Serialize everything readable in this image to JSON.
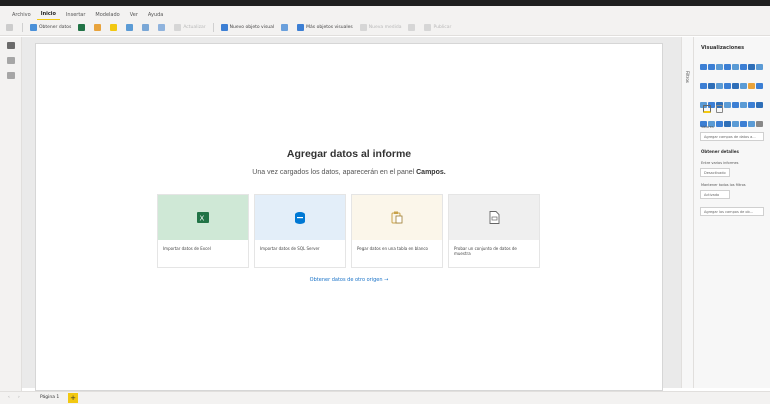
{
  "menu": [
    "Archivo",
    "Inicio",
    "Insertar",
    "Modelado",
    "Ver",
    "Ayuda"
  ],
  "ribbon": {
    "get_data": "Obtener datos",
    "import": "Actualizar",
    "new_visual": "Nuevo objeto visual",
    "more_visuals": "Más objetos visuales",
    "new_measure": "Nueva medida",
    "publish": "Publicar"
  },
  "main": {
    "title": "Agregar datos al informe",
    "subtitle_pre": "Una vez cargados los datos, aparecerán en el panel ",
    "subtitle_bold": "Campos.",
    "link": "Obtener datos de otro origen →"
  },
  "cards": [
    {
      "label": "Importar datos de Excel",
      "bg": "#cfe8d6",
      "icon_color": "#217346"
    },
    {
      "label": "Importar datos de SQL Server",
      "bg": "#e3eef9",
      "icon_color": "#0078d4"
    },
    {
      "label": "Pegar datos en una tabla en blanco",
      "bg": "#fbf6ea",
      "icon_color": "#c8a24a"
    },
    {
      "label": "Probar un conjunto de datos de muestra",
      "bg": "#efefef",
      "icon_color": "#666666"
    }
  ],
  "panes": {
    "filters": "Filtros",
    "viz_title": "Visualizaciones",
    "values_label": "Valores",
    "values_placeholder": "Agregar campos de datos a...",
    "drill_header": "Obtener detalles",
    "cross_report": "Entre varios informes",
    "toggle_off": "Desactivado",
    "keep_filters": "Mantener todos los filtros",
    "toggle_on": "Activado",
    "drill_placeholder": "Agregar los campos de ob..."
  },
  "bottom": {
    "page_tab": "Página 1",
    "add_page": "+"
  }
}
